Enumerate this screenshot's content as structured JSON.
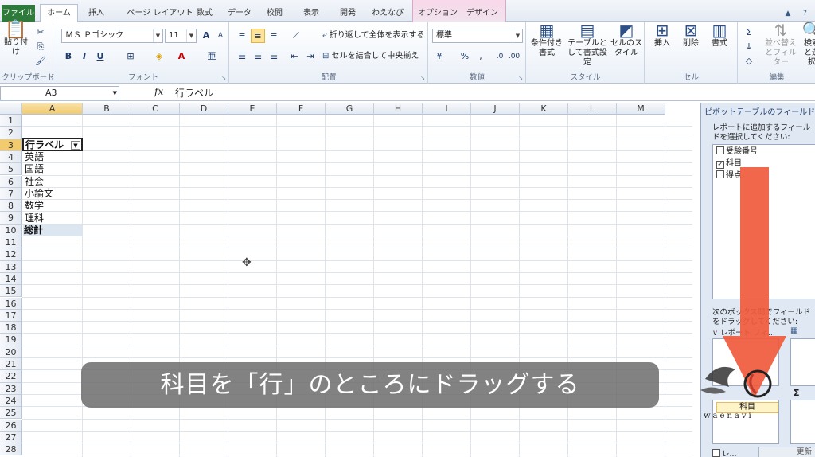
{
  "tabs": {
    "file": "ファイル",
    "items": [
      "ホーム",
      "挿入",
      "ページ レイアウト",
      "数式",
      "データ",
      "校閲",
      "表示",
      "開発",
      "わえなび"
    ],
    "contextual": [
      "オプション",
      "デザイン"
    ],
    "active": "ホーム"
  },
  "ribbon": {
    "clipboard": {
      "paste": "貼り付け",
      "label": "クリップボード"
    },
    "font": {
      "name": "ＭＳ Ｐゴシック",
      "size": "11",
      "bold": "B",
      "italic": "I",
      "underline": "U",
      "grow": "A",
      "shrink": "A",
      "label": "フォント"
    },
    "alignment": {
      "wrap": "折り返して全体を表示する",
      "merge": "セルを結合して中央揃え",
      "label": "配置"
    },
    "number": {
      "format": "標準",
      "percent": "%",
      "comma": ",",
      "label": "数値"
    },
    "styles": {
      "conditional": "条件付き書式",
      "table": "テーブルとして書式設定",
      "cell": "セルのスタイル",
      "label": "スタイル"
    },
    "cells": {
      "insert": "挿入",
      "delete": "削除",
      "format": "書式",
      "label": "セル"
    },
    "editing": {
      "sort": "並べ替えとフィルター",
      "find": "検索と選択",
      "label": "編集"
    }
  },
  "formula_bar": {
    "name_box": "A3",
    "fx": "fx",
    "content": "行ラベル"
  },
  "columns": [
    "A",
    "B",
    "C",
    "D",
    "E",
    "F",
    "G",
    "H",
    "I",
    "J",
    "K",
    "L",
    "M"
  ],
  "rows": [
    "1",
    "2",
    "3",
    "4",
    "5",
    "6",
    "7",
    "8",
    "9",
    "10",
    "11",
    "12",
    "13",
    "14",
    "15",
    "16",
    "17",
    "18",
    "19",
    "20",
    "21",
    "22",
    "23",
    "24",
    "25",
    "26",
    "27",
    "28"
  ],
  "cells": {
    "a3": "行ラベル",
    "a4": "英語",
    "a5": "国語",
    "a6": "社会",
    "a7": "小論文",
    "a8": "数学",
    "a9": "理科",
    "a10": "総計"
  },
  "caption": "科目を「行」のところにドラッグする",
  "pivot_pane": {
    "title": "ピボットテーブルのフィールド リスト",
    "choose_hint": "レポートに追加するフィールドを選択してください:",
    "fields": [
      {
        "label": "受験番号",
        "checked": false
      },
      {
        "label": "科目",
        "checked": true
      },
      {
        "label": "得点",
        "checked": false
      }
    ],
    "drag_hint": "次のボックス間でフィールドをドラッグしてください:",
    "filter_area": "レポート フィ...",
    "dragging_field": "科目",
    "defer_label": "レ...",
    "update_button": "更新"
  },
  "logo": {
    "text": "waenavi"
  },
  "colors": {
    "file_tab": "#2d7a3a",
    "arrow": "#f05a3c",
    "caption_bg": "#6e6e6e",
    "total_row": "#dce6f1"
  }
}
